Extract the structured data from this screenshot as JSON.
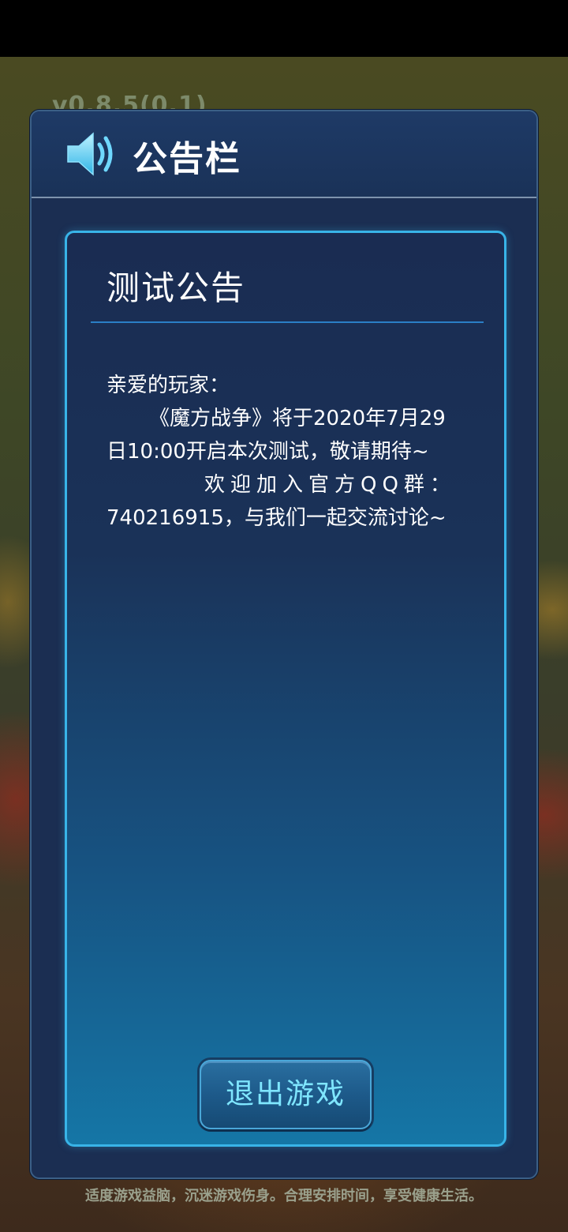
{
  "background": {
    "version_text": "v0.8.5(0.1)",
    "health_notice": "适度游戏益脑，沉迷游戏伤身。合理安排时间，享受健康生活。"
  },
  "dialog": {
    "title": "公告栏",
    "header_icon": "speaker-icon",
    "notice": {
      "title": "测试公告",
      "lines": [
        "亲爱的玩家：",
        "《魔方战争》将于2020年7月29",
        "日10:00开启本次测试，敬请期待~",
        "欢迎加入官方QQ群：",
        "740216915，与我们一起交流讨论~"
      ]
    },
    "exit_button_label": "退出游戏"
  },
  "colors": {
    "dialog_bg": "#1b2e52",
    "panel_border": "#38b4e8",
    "button_text": "#7fe6ff"
  }
}
